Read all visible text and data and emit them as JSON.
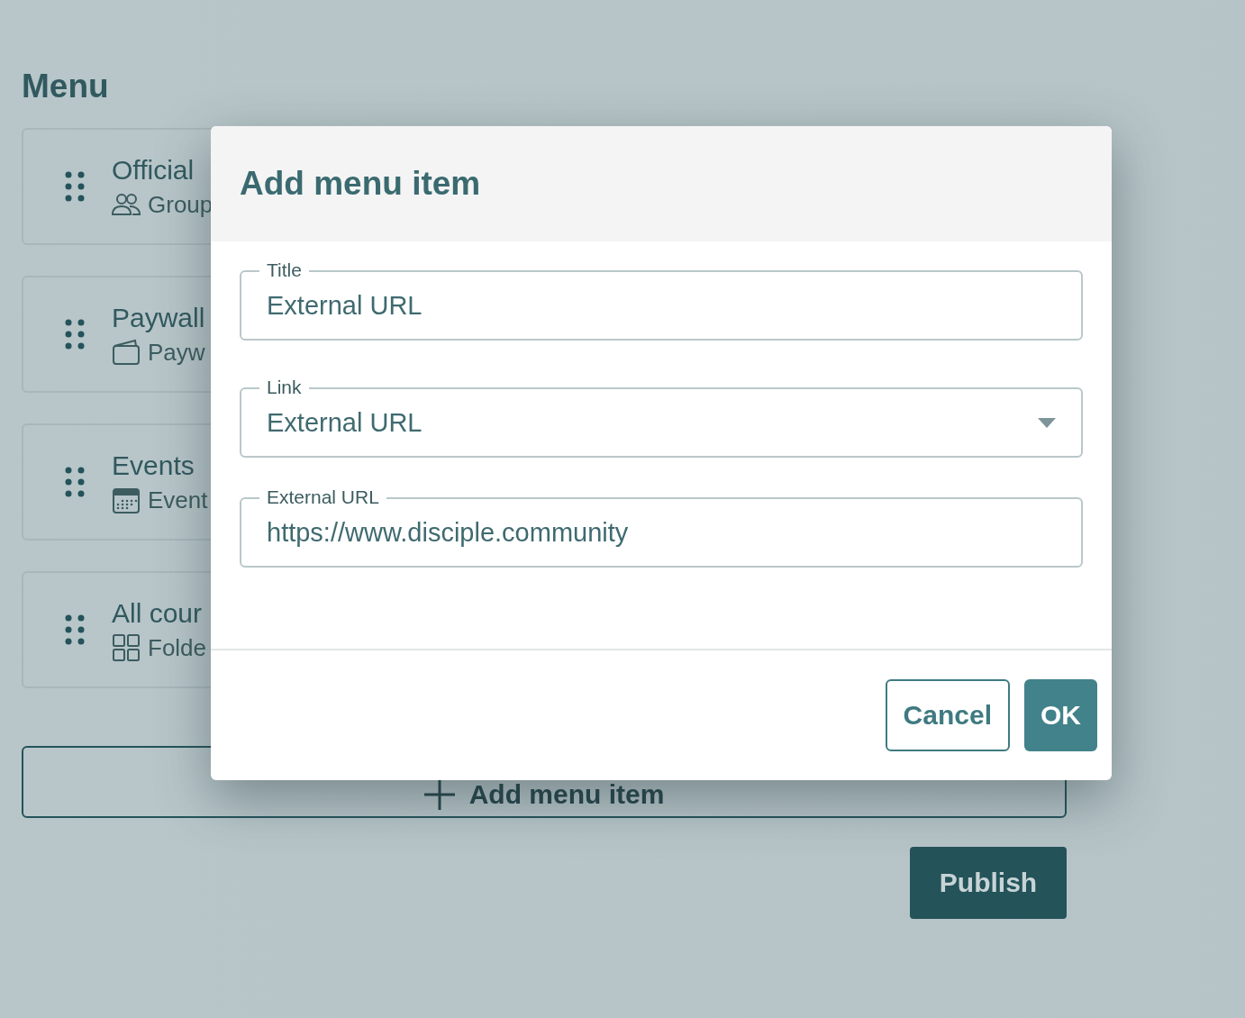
{
  "page": {
    "heading": "Menu"
  },
  "menu_items": [
    {
      "title": "Official",
      "subtitle": "Group",
      "kind": "group"
    },
    {
      "title": "Paywall",
      "subtitle": "Payw",
      "kind": "paywall"
    },
    {
      "title": "Events",
      "subtitle": "Event",
      "kind": "events"
    },
    {
      "title": "All cour",
      "subtitle": "Folde",
      "kind": "folder"
    }
  ],
  "add_button": {
    "label": "Add menu item"
  },
  "publish_button": {
    "label": "Publish"
  },
  "dialog": {
    "title": "Add menu item",
    "fields": [
      {
        "label": "Title",
        "value": "External URL",
        "kind": "text"
      },
      {
        "label": "Link",
        "value": "External URL",
        "kind": "select"
      },
      {
        "label": "External URL",
        "value": "https://www.disciple.community",
        "kind": "text"
      }
    ],
    "buttons": [
      {
        "label": "Cancel",
        "kind": "secondary"
      },
      {
        "label": "OK",
        "kind": "primary"
      }
    ]
  }
}
